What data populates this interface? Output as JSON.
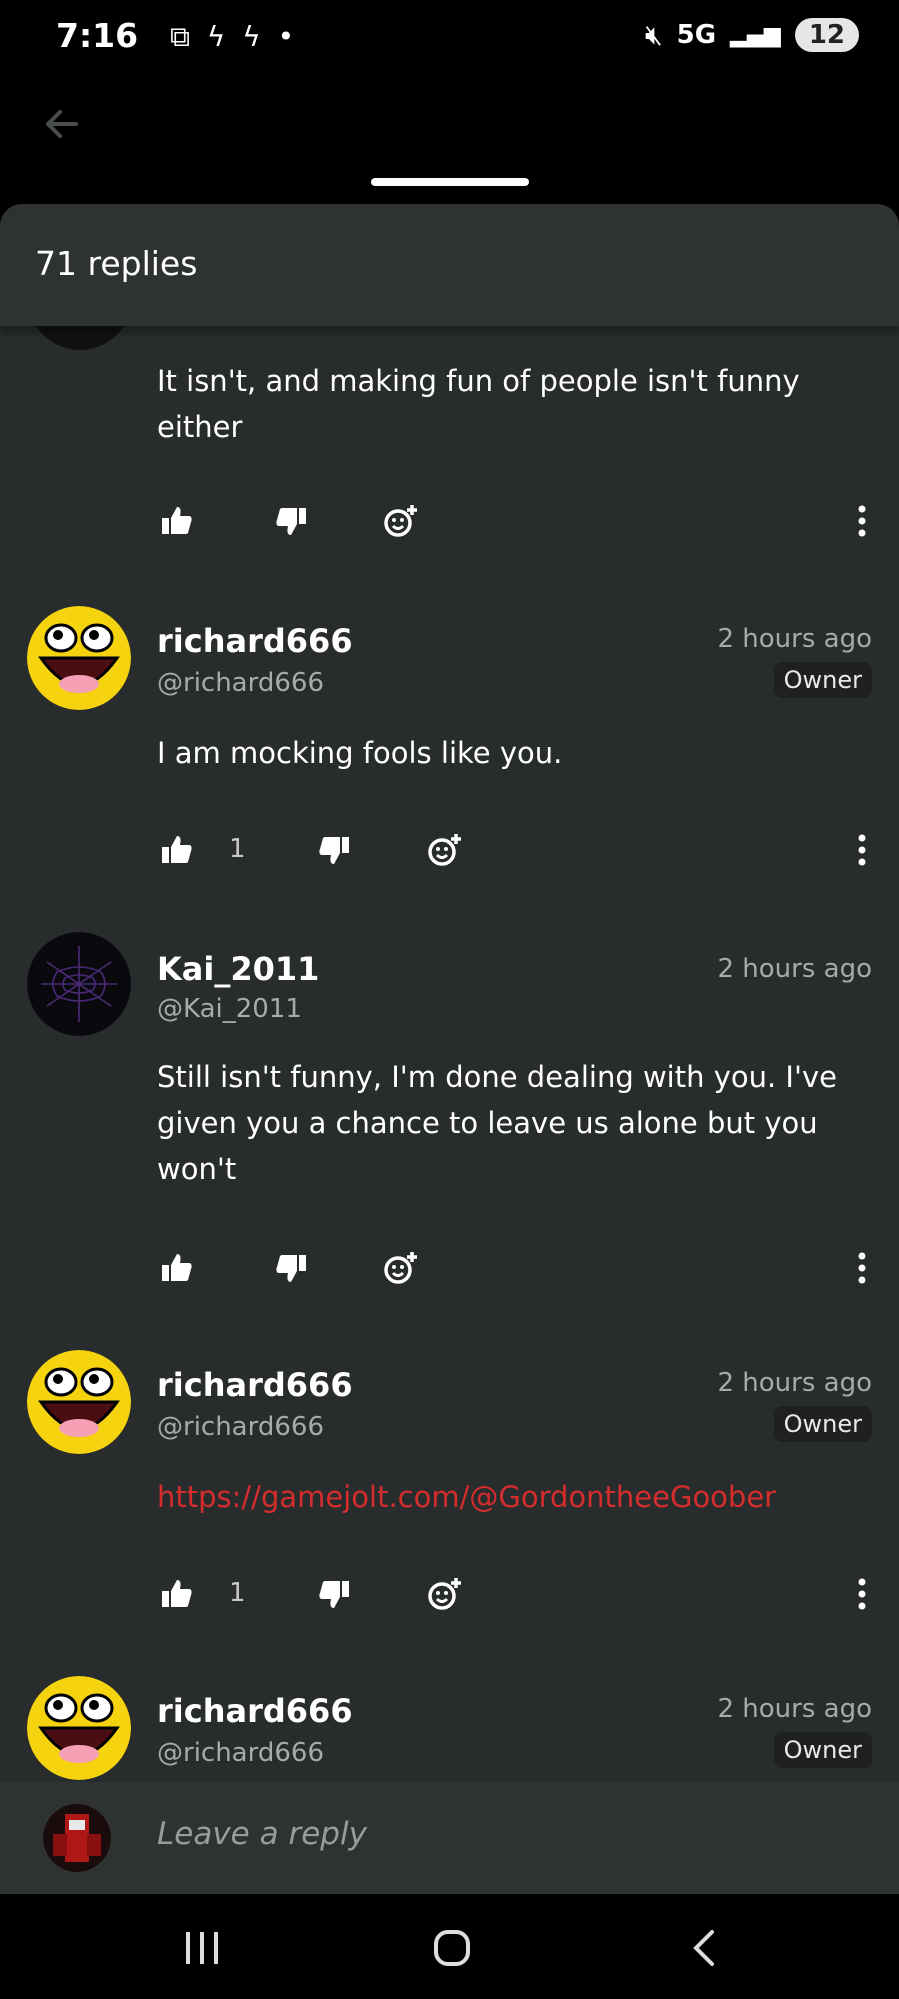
{
  "status_bar": {
    "time": "7:16",
    "left_icons": [
      "screenshot-icon",
      "bolt-icon",
      "bolt-icon",
      "dot-icon"
    ],
    "network": "5G",
    "battery": "12"
  },
  "sheet": {
    "replies_count": "71 replies"
  },
  "comments": [
    {
      "username": "",
      "handle": "",
      "time": "",
      "text": "It isn't, and making fun of people isn't funny either",
      "likes": ""
    },
    {
      "username": "richard666",
      "handle": "@richard666",
      "time": "2 hours ago",
      "badge": "Owner",
      "text": "I am mocking fools like you.",
      "likes": "1"
    },
    {
      "username": "Kai_2011",
      "handle": "@Kai_2011",
      "time": "2 hours ago",
      "text": "Still isn't funny, I'm done dealing with you. I've given you a chance to leave us alone but you won't",
      "likes": ""
    },
    {
      "username": "richard666",
      "handle": "@richard666",
      "time": "2 hours ago",
      "badge": "Owner",
      "text": "https://gamejolt.com/@GordontheeGoober",
      "likes": "1"
    },
    {
      "username": "richard666",
      "handle": "@richard666",
      "time": "2 hours ago",
      "badge": "Owner"
    }
  ],
  "reply_input": {
    "placeholder": "Leave a reply"
  },
  "colors": {
    "sheet_bg": "#292c2c",
    "header_bg": "#2f3232",
    "link": "#d42d2d",
    "muted_text": "#a8aaaa"
  }
}
